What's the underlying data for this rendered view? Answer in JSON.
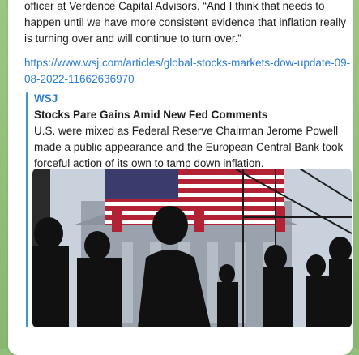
{
  "message": {
    "text": "an aggressive pace,” said Megan Horneman, chief investment officer at Verdence Capital Advisors. “And I think that needs to happen until we have more consistent evidence that inflation really is turning over and will continue to turn over.”",
    "link": "https://www.wsj.com/articles/global-stocks-markets-dow-update-09-08-2022-11662636970"
  },
  "preview": {
    "site": "WSJ",
    "title": "Stocks Pare Gains Amid New Fed Comments",
    "description": "U.S. were mixed as Federal Reserve Chairman Jerome Powell made a public appearance and the European Central Bank took forceful action of its own to tamp down inflation.",
    "image_alt": "New York Stock Exchange facade with US flag and silhouetted pedestrians"
  },
  "colors": {
    "link": "#2a7bd0",
    "accent_bar": "#3f95d6",
    "bubble": "#ffffff",
    "background": "#8fbf7a"
  }
}
